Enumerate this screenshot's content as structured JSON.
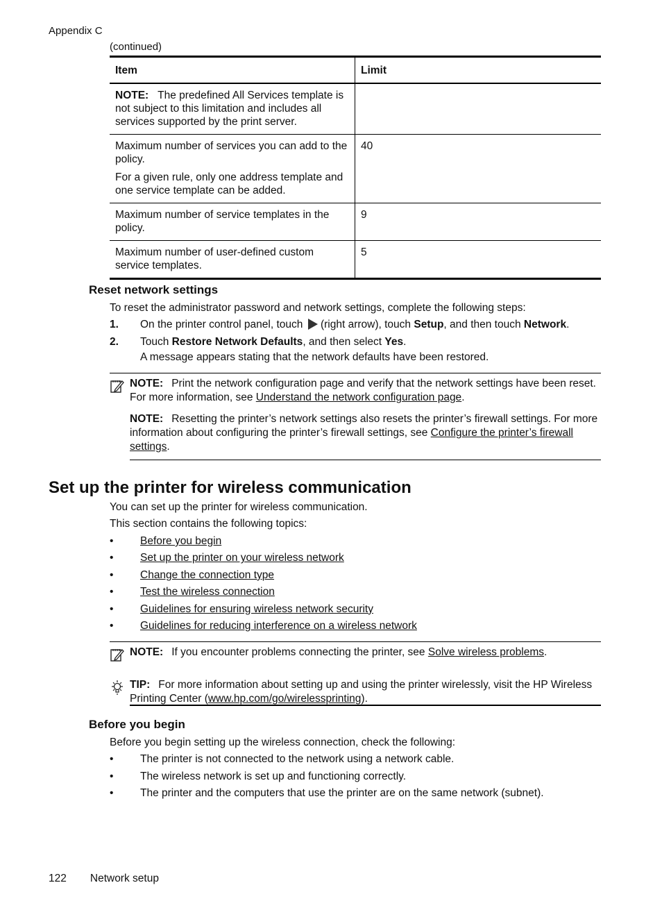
{
  "header": {
    "running_head": "Appendix C",
    "continued": "(continued)"
  },
  "table": {
    "columns": [
      "Item",
      "Limit"
    ],
    "rows": [
      {
        "item_label": "NOTE:",
        "item": [
          "The predefined All Services template is not subject to this limitation and includes all services supported by the print server."
        ],
        "limit": ""
      },
      {
        "item": [
          "Maximum number of services you can add to the policy.",
          "For a given rule, only one address template and one service template can be added."
        ],
        "limit": "40"
      },
      {
        "item": [
          "Maximum number of service templates in the policy."
        ],
        "limit": "9"
      },
      {
        "item": [
          "Maximum number of user-defined custom service templates."
        ],
        "limit": "5"
      }
    ]
  },
  "reset": {
    "heading": "Reset network settings",
    "intro": "To reset the administrator password and network settings, complete the following steps:",
    "steps": [
      {
        "num": "1.",
        "t1": "On the printer control panel, touch ",
        "icon": "right-arrow-icon",
        "t2": " (right arrow), touch ",
        "b1": "Setup",
        "t3": ", and then touch ",
        "b2": "Network",
        "t4": "."
      },
      {
        "num": "2.",
        "t1": "Touch ",
        "b1": "Restore Network Defaults",
        "t2": ", and then select ",
        "b2": "Yes",
        "t3": ".",
        "sub": "A message appears stating that the network defaults have been restored."
      }
    ],
    "notes": [
      {
        "label": "NOTE:",
        "text": "Print the network configuration page and verify that the network settings have been reset. For more information, see ",
        "link": "Understand the network configuration page",
        "after": "."
      },
      {
        "label": "NOTE:",
        "text": "Resetting the printer’s network settings also resets the printer’s firewall settings. For more information about configuring the printer’s firewall settings, see ",
        "link": "Configure the printer’s firewall settings",
        "after": "."
      }
    ]
  },
  "wireless": {
    "heading": "Set up the printer for wireless communication",
    "intro1": "You can set up the printer for wireless communication.",
    "intro2": "This section contains the following topics:",
    "topics": [
      "Before you begin",
      "Set up the printer on your wireless network",
      "Change the connection type",
      "Test the wireless connection",
      "Guidelines for ensuring wireless network security",
      "Guidelines for reducing interference on a wireless network"
    ],
    "note": {
      "label": "NOTE:",
      "text": "If you encounter problems connecting the printer, see ",
      "link": "Solve wireless problems",
      "after": "."
    },
    "tip": {
      "label": "TIP:",
      "text": "For more information about setting up and using the printer wirelessly, visit the HP Wireless Printing Center (",
      "link": "www.hp.com/go/wirelessprinting",
      "after": ")."
    }
  },
  "before": {
    "heading": "Before you begin",
    "intro": "Before you begin setting up the wireless connection, check the following:",
    "items": [
      "The printer is not connected to the network using a network cable.",
      "The wireless network is set up and functioning correctly.",
      "The printer and the computers that use the printer are on the same network (subnet)."
    ]
  },
  "footer": {
    "page_number": "122",
    "section": "Network setup"
  }
}
